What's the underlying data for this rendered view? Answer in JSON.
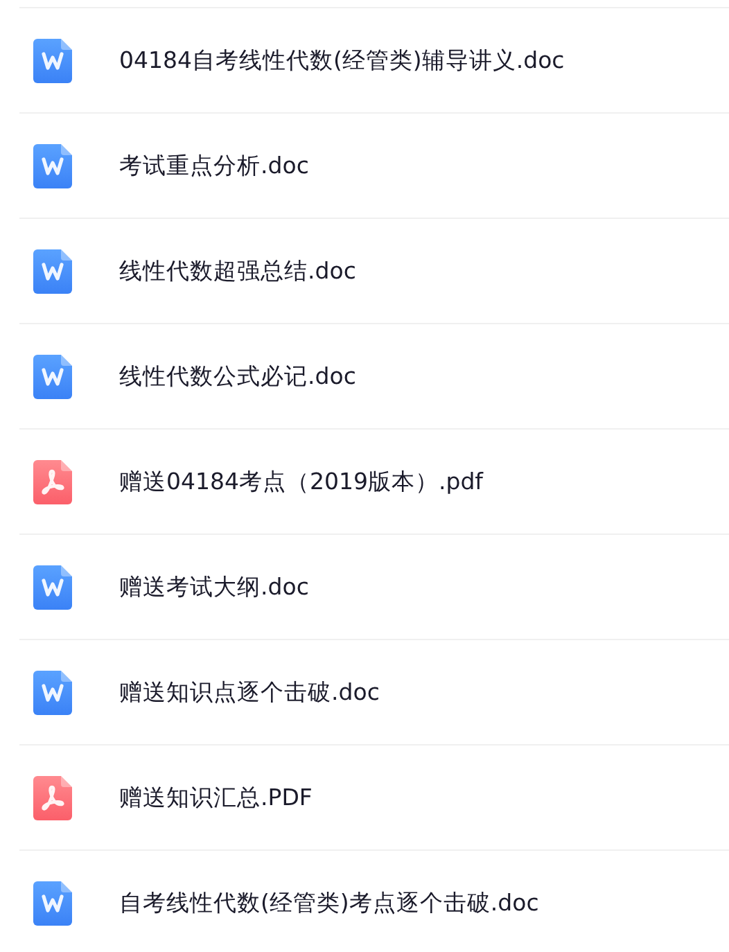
{
  "files": [
    {
      "kind": "doc",
      "name": "04184自考线性代数(经管类)辅导讲义.doc"
    },
    {
      "kind": "doc",
      "name": "考试重点分析.doc"
    },
    {
      "kind": "doc",
      "name": "线性代数超强总结.doc"
    },
    {
      "kind": "doc",
      "name": "线性代数公式必记.doc"
    },
    {
      "kind": "pdf",
      "name": "赠送04184考点（2019版本）.pdf"
    },
    {
      "kind": "doc",
      "name": "赠送考试大纲.doc"
    },
    {
      "kind": "doc",
      "name": "赠送知识点逐个击破.doc"
    },
    {
      "kind": "pdf",
      "name": "赠送知识汇总.PDF"
    },
    {
      "kind": "doc",
      "name": "自考线性代数(经管类)考点逐个击破.doc"
    }
  ]
}
